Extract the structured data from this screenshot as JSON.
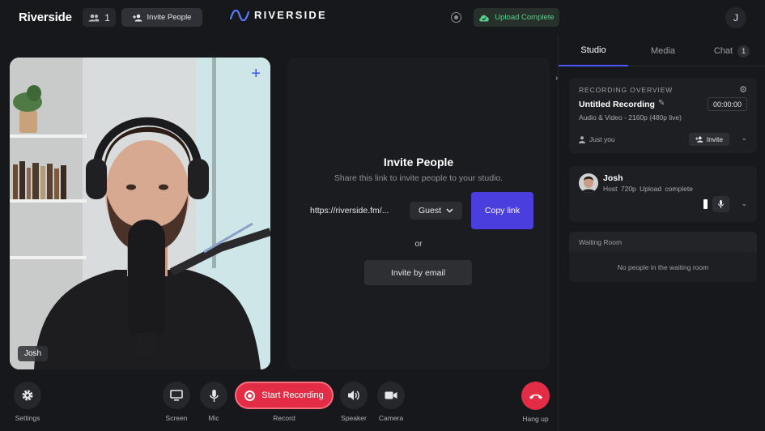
{
  "header": {
    "brand": "Riverside",
    "participant_count": "1",
    "invite_button": "Invite People",
    "logo_text": "RIVERSIDE",
    "upload_status": "Upload Complete",
    "user_initial": "J"
  },
  "video": {
    "participant_name": "Josh"
  },
  "invite_panel": {
    "title": "Invite People",
    "subtitle": "Share this link to invite people to your studio.",
    "link": "https://riverside.fm/...",
    "role": "Guest",
    "copy_button": "Copy link",
    "or_label": "or",
    "email_button": "Invite by email"
  },
  "sidebar": {
    "tabs": [
      {
        "label": "Studio"
      },
      {
        "label": "Media"
      },
      {
        "label": "Chat",
        "badge": "1"
      }
    ],
    "recording": {
      "section_label": "RECORDING OVERVIEW",
      "title": "Untitled Recording",
      "timer": "00:00:00",
      "meta": "Audio & Video - 2160p (480p live)",
      "audience": "Just you",
      "invite_button": "Invite"
    },
    "host": {
      "name": "Josh",
      "role": "Host",
      "resolution": "720p",
      "status": "Upload complete"
    },
    "waiting_room": {
      "title": "Waiting Room",
      "empty_text": "No people in the waiting room"
    }
  },
  "toolbar": {
    "settings": "Settings",
    "screen": "Screen",
    "mic": "Mic",
    "record_button": "Start Recording",
    "record_label": "Record",
    "speaker": "Speaker",
    "camera": "Camera",
    "hangup": "Hang up"
  },
  "colors": {
    "accent_purple": "#4b3ede",
    "record_red": "#e32d47",
    "upload_green": "#58d08a",
    "background": "#17181b"
  }
}
